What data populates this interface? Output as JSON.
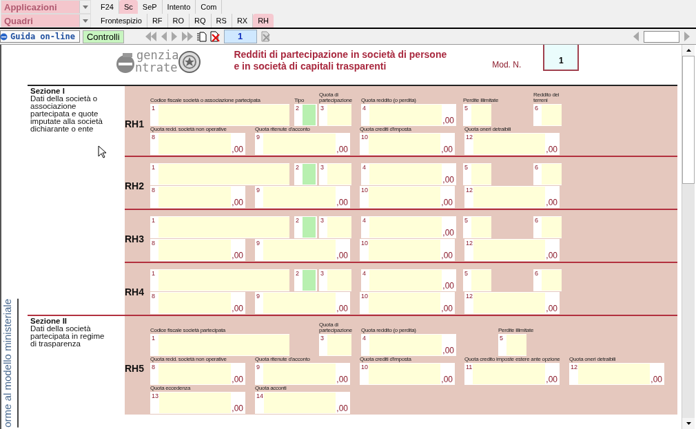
{
  "top_bar": {
    "combos": [
      {
        "label": "Applicazioni"
      },
      {
        "label": "Quadri"
      }
    ],
    "tab_rows": [
      {
        "tabs": [
          {
            "label": "F24",
            "selected": false
          },
          {
            "label": "Sc",
            "selected": true
          },
          {
            "label": "SeP",
            "selected": false
          },
          {
            "label": "Intento",
            "selected": false
          },
          {
            "label": "Com",
            "selected": false
          }
        ]
      },
      {
        "tabs": [
          {
            "label": "Frontespizio",
            "selected": false
          },
          {
            "label": "RF",
            "selected": false
          },
          {
            "label": "RO",
            "selected": false
          },
          {
            "label": "RQ",
            "selected": false
          },
          {
            "label": "RS",
            "selected": false
          },
          {
            "label": "RX",
            "selected": false
          },
          {
            "label": "RH",
            "selected": true
          }
        ]
      }
    ]
  },
  "toolbar": {
    "help_button": "Guida on-line",
    "check_button": "Controlli",
    "page_number": "1"
  },
  "header": {
    "logo_lines": [
      "genzia",
      "ntrate"
    ],
    "title_lines": [
      "Redditi di partecipazione in società di persone",
      "e in società di capitali trasparenti"
    ],
    "model_label": "Mod. N.",
    "model_number": "1"
  },
  "side_caption": "orme al modello ministeriale",
  "sections": [
    {
      "title": "Sezione I",
      "description": "Dati della società o associazione partecipata e quote imputate alla società dichiarante o ente",
      "records": [
        {
          "code": "RH1",
          "lines": [
            [
              {
                "number": "1",
                "kind": "code",
                "label": "Codice fiscale società o associazione partecipata"
              },
              {
                "number": "2",
                "kind": "type",
                "label": "Tipo"
              },
              {
                "number": "3",
                "kind": "share",
                "label": "Quota di partecipazione"
              },
              {
                "number": "4",
                "kind": "amount",
                "label": "Quota reddito (o perdita)",
                "suffix": ",00"
              },
              {
                "number": "5",
                "kind": "small",
                "label": "Perdite illimitate"
              },
              {
                "number": "6",
                "kind": "small",
                "label": "Reddito dei terreni"
              }
            ],
            [
              {
                "number": "8",
                "kind": "amount",
                "label": "Quota redd. società non operative",
                "suffix": ",00"
              },
              {
                "number": "9",
                "kind": "amount",
                "label": "Quota ritenute d'acconto",
                "suffix": ",00"
              },
              {
                "number": "10",
                "kind": "amount",
                "label": "Quota crediti d'imposta",
                "suffix": ",00"
              },
              {
                "number": "12",
                "kind": "amount",
                "label": "Quota oneri detraibili",
                "suffix": ",00"
              }
            ]
          ]
        },
        {
          "code": "RH2",
          "lines": [
            [
              {
                "number": "1",
                "kind": "code"
              },
              {
                "number": "2",
                "kind": "type"
              },
              {
                "number": "3",
                "kind": "share"
              },
              {
                "number": "4",
                "kind": "amount",
                "suffix": ",00"
              },
              {
                "number": "5",
                "kind": "small"
              },
              {
                "number": "6",
                "kind": "small"
              }
            ],
            [
              {
                "number": "8",
                "kind": "amount",
                "suffix": ",00"
              },
              {
                "number": "9",
                "kind": "amount",
                "suffix": ",00"
              },
              {
                "number": "10",
                "kind": "amount",
                "suffix": ",00"
              },
              {
                "number": "12",
                "kind": "amount",
                "suffix": ",00"
              }
            ]
          ]
        },
        {
          "code": "RH3",
          "lines": [
            [
              {
                "number": "1",
                "kind": "code"
              },
              {
                "number": "2",
                "kind": "type"
              },
              {
                "number": "3",
                "kind": "share"
              },
              {
                "number": "4",
                "kind": "amount",
                "suffix": ",00"
              },
              {
                "number": "5",
                "kind": "small"
              },
              {
                "number": "6",
                "kind": "small"
              }
            ],
            [
              {
                "number": "8",
                "kind": "amount",
                "suffix": ",00"
              },
              {
                "number": "9",
                "kind": "amount",
                "suffix": ",00"
              },
              {
                "number": "10",
                "kind": "amount",
                "suffix": ",00"
              },
              {
                "number": "12",
                "kind": "amount",
                "suffix": ",00"
              }
            ]
          ]
        },
        {
          "code": "RH4",
          "lines": [
            [
              {
                "number": "1",
                "kind": "code"
              },
              {
                "number": "2",
                "kind": "type"
              },
              {
                "number": "3",
                "kind": "share"
              },
              {
                "number": "4",
                "kind": "amount",
                "suffix": ",00"
              },
              {
                "number": "5",
                "kind": "small"
              },
              {
                "number": "6",
                "kind": "small"
              }
            ],
            [
              {
                "number": "8",
                "kind": "amount",
                "suffix": ",00"
              },
              {
                "number": "9",
                "kind": "amount",
                "suffix": ",00"
              },
              {
                "number": "10",
                "kind": "amount",
                "suffix": ",00"
              },
              {
                "number": "12",
                "kind": "amount",
                "suffix": ",00"
              }
            ]
          ]
        }
      ]
    },
    {
      "title": "Sezione II",
      "description": "Dati della società partecipata in regime di trasparenza",
      "records": [
        {
          "code": "RH5",
          "lines": [
            [
              {
                "number": "1",
                "kind": "code",
                "label": "Codice fiscale società partecipata"
              },
              {
                "number": "3",
                "kind": "share",
                "label": "Quota di partecipazione"
              },
              {
                "number": "4",
                "kind": "amount",
                "label": "Quota reddito (o perdita)",
                "suffix": ",00"
              },
              {
                "number": "5",
                "kind": "small",
                "label": "Perdite illimitate"
              }
            ],
            [
              {
                "number": "8",
                "kind": "amount",
                "label": "Quota redd. società non operative",
                "suffix": ",00"
              },
              {
                "number": "9",
                "kind": "amount",
                "label": "Quota ritenute d'acconto",
                "suffix": ",00"
              },
              {
                "number": "10",
                "kind": "amount",
                "label": "Quota crediti d'imposta",
                "suffix": ",00"
              },
              {
                "number": "11",
                "kind": "amount",
                "label": "Quota credito imposte estere ante opzione",
                "suffix": ",00"
              },
              {
                "number": "12",
                "kind": "amount",
                "label": "Quota oneri detraibili",
                "suffix": ",00"
              }
            ],
            [
              {
                "number": "13",
                "kind": "amount",
                "label": "Quota eccedenza",
                "suffix": ",00"
              },
              {
                "number": "14",
                "kind": "amount",
                "label": "Quota acconti",
                "suffix": ",00"
              }
            ]
          ]
        }
      ]
    }
  ]
}
